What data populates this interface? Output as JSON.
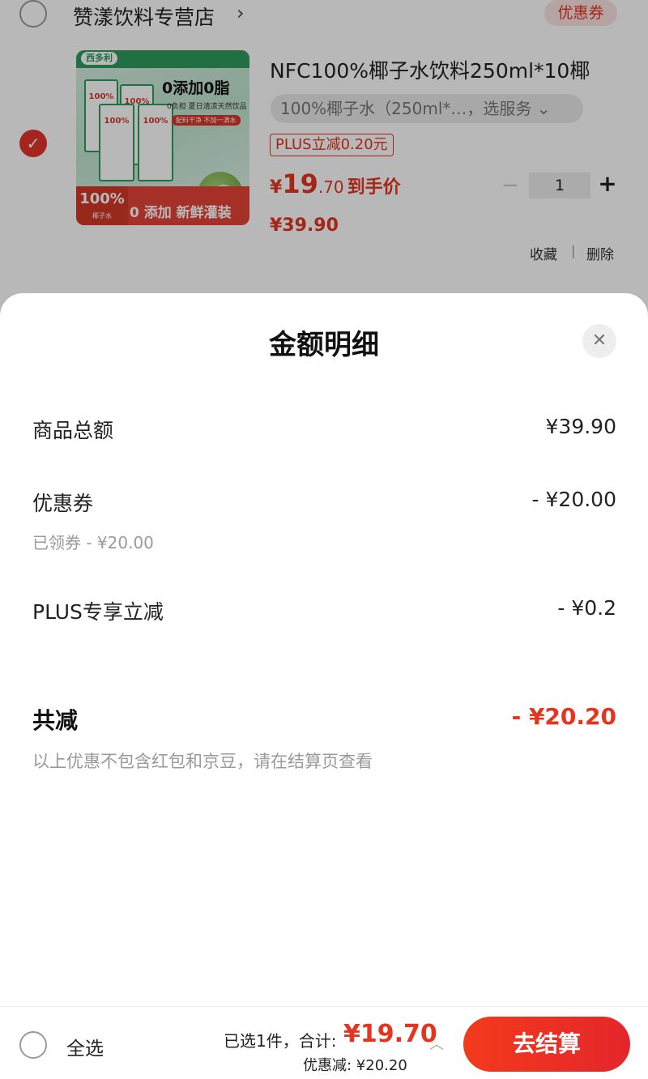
{
  "shop": {
    "name": "赞漾饮料专营店",
    "arrow": "›",
    "coupon_tag": "优惠券"
  },
  "item": {
    "title": "NFC100%椰子水饮料250ml*10椰",
    "spec": "100%椰子水（250ml*…，选服务 ⌄",
    "plus_tag": "PLUS立减0.20元",
    "price_currency": "¥",
    "price_int": "19",
    "price_dec": ".70",
    "price_suffix": "到手价",
    "original_price": "¥39.90",
    "qty_minus": "−",
    "qty": "1",
    "qty_plus": "+",
    "check": "✓",
    "favorite": "收藏",
    "separator": "|",
    "delete": "删除",
    "image": {
      "brand": "西多利",
      "slogan": "0添加0脂",
      "subtext": "0负担 夏日清凉天然饮品",
      "pill": "配料干净 不加一滴水",
      "box_label": "100%",
      "banner_left": "100%",
      "banner_left_small": "椰子水",
      "banner_text": "0 添加 新鲜灌装"
    }
  },
  "sheet": {
    "title": "金额明细",
    "close_icon": "✕",
    "rows": [
      {
        "label": "商品总额",
        "value": "¥39.90"
      },
      {
        "label": "优惠券",
        "value": "- ¥20.00",
        "sub": "已领券 - ¥20.00"
      },
      {
        "label": "PLUS专享立减",
        "value": "- ¥0.2"
      }
    ],
    "total_label": "共减",
    "total_value": "- ¥20.20",
    "note": "以上优惠不包含红包和京豆，请在结算页查看"
  },
  "bottom": {
    "select_all": "全选",
    "selected_text": "已选1件，合计:",
    "sum": "¥19.70",
    "caret": "︿",
    "discount_text": "优惠减: ¥20.20",
    "checkout": "去结算"
  },
  "colors": {
    "accent": "#e5341f",
    "checkout": "#e4262b"
  }
}
